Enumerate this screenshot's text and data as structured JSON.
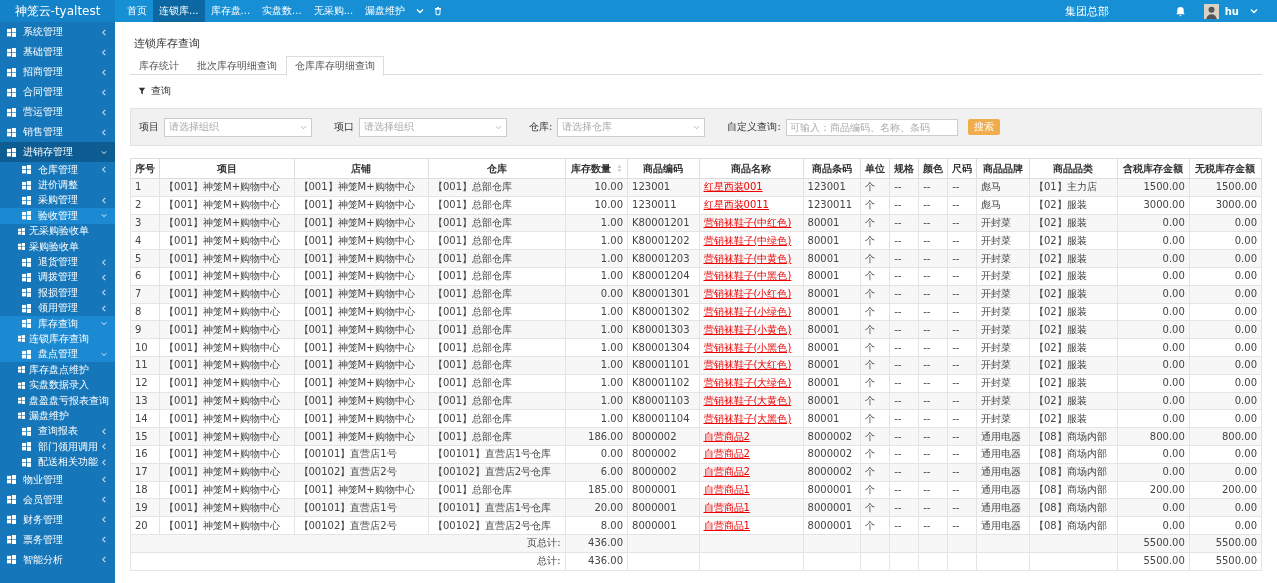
{
  "topbar": {
    "brand": "神笼云-tyaltest",
    "tabs": [
      {
        "label": "首页",
        "selected": false
      },
      {
        "label": "连锁库...",
        "selected": true
      },
      {
        "label": "库存盘...",
        "selected": false
      },
      {
        "label": "实盘数...",
        "selected": false
      },
      {
        "label": "无采购...",
        "selected": false
      },
      {
        "label": "漏盘维护",
        "selected": false
      }
    ],
    "org": "集团总部",
    "user": "hu"
  },
  "sidebar": {
    "items": [
      {
        "label": "系统管理",
        "expandable": true,
        "expanded": false,
        "selected": false
      },
      {
        "label": "基础管理",
        "expandable": true,
        "expanded": false,
        "selected": false
      },
      {
        "label": "招商管理",
        "expandable": true,
        "expanded": false,
        "selected": false
      },
      {
        "label": "合同管理",
        "expandable": true,
        "expanded": false,
        "selected": false
      },
      {
        "label": "营运管理",
        "expandable": true,
        "expanded": false,
        "selected": false
      },
      {
        "label": "销售管理",
        "expandable": true,
        "expanded": false,
        "selected": false
      },
      {
        "label": "进销存管理",
        "expandable": true,
        "expanded": true,
        "selected": true,
        "children": [
          {
            "label": "仓库管理",
            "expandable": true,
            "expanded": false,
            "selected": false
          },
          {
            "label": "进价调整",
            "expandable": false,
            "selected": false
          },
          {
            "label": "采购管理",
            "expandable": true,
            "expanded": false,
            "selected": false
          },
          {
            "label": "验收管理",
            "expandable": true,
            "expanded": true,
            "selected": true,
            "children": [
              {
                "label": "无采购验收单",
                "expandable": false,
                "selected": false
              },
              {
                "label": "采购验收单",
                "expandable": false,
                "selected": false
              }
            ]
          },
          {
            "label": "退货管理",
            "expandable": true,
            "expanded": false,
            "selected": false
          },
          {
            "label": "调拨管理",
            "expandable": true,
            "expanded": false,
            "selected": false
          },
          {
            "label": "报损管理",
            "expandable": true,
            "expanded": false,
            "selected": false
          },
          {
            "label": "领用管理",
            "expandable": true,
            "expanded": false,
            "selected": false
          },
          {
            "label": "库存查询",
            "expandable": true,
            "expanded": true,
            "selected": true,
            "children": [
              {
                "label": "连锁库存查询",
                "expandable": false,
                "selected": true
              }
            ]
          },
          {
            "label": "盘点管理",
            "expandable": true,
            "expanded": true,
            "selected": true,
            "children": [
              {
                "label": "库存盘点维护",
                "expandable": false,
                "selected": false
              },
              {
                "label": "实盘数据录入",
                "expandable": false,
                "selected": false
              },
              {
                "label": "盘盈盘亏报表查询",
                "expandable": false,
                "selected": false
              },
              {
                "label": "漏盘维护",
                "expandable": false,
                "selected": false
              }
            ]
          },
          {
            "label": "查询报表",
            "expandable": true,
            "expanded": false,
            "selected": false
          },
          {
            "label": "部门领用调用",
            "expandable": true,
            "expanded": false,
            "selected": false
          },
          {
            "label": "配送相关功能",
            "expandable": true,
            "expanded": false,
            "selected": false
          }
        ]
      },
      {
        "label": "物业管理",
        "expandable": true,
        "expanded": false,
        "selected": false
      },
      {
        "label": "会员管理",
        "expandable": true,
        "expanded": false,
        "selected": false
      },
      {
        "label": "财务管理",
        "expandable": true,
        "expanded": false,
        "selected": false
      },
      {
        "label": "票务管理",
        "expandable": true,
        "expanded": false,
        "selected": false
      },
      {
        "label": "智能分析",
        "expandable": true,
        "expanded": false,
        "selected": false
      }
    ]
  },
  "page": {
    "title": "连锁库存查询",
    "tabs": [
      {
        "label": "库存统计",
        "selected": false
      },
      {
        "label": "批次库存明细查询",
        "selected": false
      },
      {
        "label": "仓库库存明细查询",
        "selected": true
      }
    ],
    "query_button": "查询",
    "filters": [
      {
        "kind": "select",
        "label": "项目",
        "placeholder": "请选择组织"
      },
      {
        "kind": "select",
        "label": "项口",
        "placeholder": "请选择组织"
      },
      {
        "kind": "select",
        "label": "仓库:",
        "placeholder": "请选择仓库"
      },
      {
        "kind": "text",
        "label": "自定义查询:",
        "placeholder": "可输入：商品编码、名称、条码"
      }
    ],
    "search_button": "搜索"
  },
  "table": {
    "columns": [
      {
        "label": "序号",
        "kind": "index",
        "sortable": false
      },
      {
        "label": "项目",
        "kind": "text",
        "sortable": false
      },
      {
        "label": "店铺",
        "kind": "text",
        "sortable": false
      },
      {
        "label": "仓库",
        "kind": "text",
        "sortable": false
      },
      {
        "label": "库存数量",
        "kind": "number",
        "sortable": true
      },
      {
        "label": "商品编码",
        "kind": "text",
        "sortable": false
      },
      {
        "label": "商品名称",
        "kind": "link",
        "sortable": false
      },
      {
        "label": "商品条码",
        "kind": "text",
        "sortable": false
      },
      {
        "label": "单位",
        "kind": "text",
        "sortable": false
      },
      {
        "label": "规格",
        "kind": "text",
        "sortable": false
      },
      {
        "label": "颜色",
        "kind": "text",
        "sortable": false
      },
      {
        "label": "尺码",
        "kind": "text",
        "sortable": false
      },
      {
        "label": "商品品牌",
        "kind": "text",
        "sortable": false
      },
      {
        "label": "商品品类",
        "kind": "text",
        "sortable": false
      },
      {
        "label": "含税库存金额",
        "kind": "number",
        "sortable": false
      },
      {
        "label": "无税库存金额",
        "kind": "number",
        "sortable": false
      }
    ],
    "rows": [
      [
        "1",
        "【001】神笼M+购物中心",
        "【001】神笼M+购物中心",
        "【001】总部仓库",
        "10.00",
        "123001",
        "红星西装001",
        "123001",
        "个",
        "--",
        "--",
        "--",
        "彪马",
        "【01】主力店",
        "1500.00",
        "1500.00"
      ],
      [
        "2",
        "【001】神笼M+购物中心",
        "【001】神笼M+购物中心",
        "【001】总部仓库",
        "10.00",
        "1230011",
        "红星西装0011",
        "1230011",
        "个",
        "--",
        "--",
        "--",
        "彪马",
        "【02】服装",
        "3000.00",
        "3000.00"
      ],
      [
        "3",
        "【001】神笼M+购物中心",
        "【001】神笼M+购物中心",
        "【001】总部仓库",
        "1.00",
        "K80001201",
        "营销袜鞋子(中红色)",
        "80001",
        "个",
        "--",
        "--",
        "--",
        "开封菜",
        "【02】服装",
        "0.00",
        "0.00"
      ],
      [
        "4",
        "【001】神笼M+购物中心",
        "【001】神笼M+购物中心",
        "【001】总部仓库",
        "1.00",
        "K80001202",
        "营销袜鞋子(中绿色)",
        "80001",
        "个",
        "--",
        "--",
        "--",
        "开封菜",
        "【02】服装",
        "0.00",
        "0.00"
      ],
      [
        "5",
        "【001】神笼M+购物中心",
        "【001】神笼M+购物中心",
        "【001】总部仓库",
        "1.00",
        "K80001203",
        "营销袜鞋子(中黄色)",
        "80001",
        "个",
        "--",
        "--",
        "--",
        "开封菜",
        "【02】服装",
        "0.00",
        "0.00"
      ],
      [
        "6",
        "【001】神笼M+购物中心",
        "【001】神笼M+购物中心",
        "【001】总部仓库",
        "1.00",
        "K80001204",
        "营销袜鞋子(中黑色)",
        "80001",
        "个",
        "--",
        "--",
        "--",
        "开封菜",
        "【02】服装",
        "0.00",
        "0.00"
      ],
      [
        "7",
        "【001】神笼M+购物中心",
        "【001】神笼M+购物中心",
        "【001】总部仓库",
        "0.00",
        "K80001301",
        "营销袜鞋子(小红色)",
        "80001",
        "个",
        "--",
        "--",
        "--",
        "开封菜",
        "【02】服装",
        "0.00",
        "0.00"
      ],
      [
        "8",
        "【001】神笼M+购物中心",
        "【001】神笼M+购物中心",
        "【001】总部仓库",
        "1.00",
        "K80001302",
        "营销袜鞋子(小绿色)",
        "80001",
        "个",
        "--",
        "--",
        "--",
        "开封菜",
        "【02】服装",
        "0.00",
        "0.00"
      ],
      [
        "9",
        "【001】神笼M+购物中心",
        "【001】神笼M+购物中心",
        "【001】总部仓库",
        "1.00",
        "K80001303",
        "营销袜鞋子(小黄色)",
        "80001",
        "个",
        "--",
        "--",
        "--",
        "开封菜",
        "【02】服装",
        "0.00",
        "0.00"
      ],
      [
        "10",
        "【001】神笼M+购物中心",
        "【001】神笼M+购物中心",
        "【001】总部仓库",
        "1.00",
        "K80001304",
        "营销袜鞋子(小黑色)",
        "80001",
        "个",
        "--",
        "--",
        "--",
        "开封菜",
        "【02】服装",
        "0.00",
        "0.00"
      ],
      [
        "11",
        "【001】神笼M+购物中心",
        "【001】神笼M+购物中心",
        "【001】总部仓库",
        "1.00",
        "K80001101",
        "营销袜鞋子(大红色)",
        "80001",
        "个",
        "--",
        "--",
        "--",
        "开封菜",
        "【02】服装",
        "0.00",
        "0.00"
      ],
      [
        "12",
        "【001】神笼M+购物中心",
        "【001】神笼M+购物中心",
        "【001】总部仓库",
        "1.00",
        "K80001102",
        "营销袜鞋子(大绿色)",
        "80001",
        "个",
        "--",
        "--",
        "--",
        "开封菜",
        "【02】服装",
        "0.00",
        "0.00"
      ],
      [
        "13",
        "【001】神笼M+购物中心",
        "【001】神笼M+购物中心",
        "【001】总部仓库",
        "1.00",
        "K80001103",
        "营销袜鞋子(大黄色)",
        "80001",
        "个",
        "--",
        "--",
        "--",
        "开封菜",
        "【02】服装",
        "0.00",
        "0.00"
      ],
      [
        "14",
        "【001】神笼M+购物中心",
        "【001】神笼M+购物中心",
        "【001】总部仓库",
        "1.00",
        "K80001104",
        "营销袜鞋子(大黑色)",
        "80001",
        "个",
        "--",
        "--",
        "--",
        "开封菜",
        "【02】服装",
        "0.00",
        "0.00"
      ],
      [
        "15",
        "【001】神笼M+购物中心",
        "【001】神笼M+购物中心",
        "【001】总部仓库",
        "186.00",
        "8000002",
        "自营商品2",
        "8000002",
        "个",
        "--",
        "--",
        "--",
        "通用电器",
        "【08】商场内部",
        "800.00",
        "800.00"
      ],
      [
        "16",
        "【001】神笼M+购物中心",
        "【00101】直营店1号",
        "【00101】直营店1号仓库",
        "0.00",
        "8000002",
        "自营商品2",
        "8000002",
        "个",
        "--",
        "--",
        "--",
        "通用电器",
        "【08】商场内部",
        "0.00",
        "0.00"
      ],
      [
        "17",
        "【001】神笼M+购物中心",
        "【00102】直营店2号",
        "【00102】直营店2号仓库",
        "6.00",
        "8000002",
        "自营商品2",
        "8000002",
        "个",
        "--",
        "--",
        "--",
        "通用电器",
        "【08】商场内部",
        "0.00",
        "0.00"
      ],
      [
        "18",
        "【001】神笼M+购物中心",
        "【001】神笼M+购物中心",
        "【001】总部仓库",
        "185.00",
        "8000001",
        "自营商品1",
        "8000001",
        "个",
        "--",
        "--",
        "--",
        "通用电器",
        "【08】商场内部",
        "200.00",
        "200.00"
      ],
      [
        "19",
        "【001】神笼M+购物中心",
        "【00101】直营店1号",
        "【00101】直营店1号仓库",
        "20.00",
        "8000001",
        "自营商品1",
        "8000001",
        "个",
        "--",
        "--",
        "--",
        "通用电器",
        "【08】商场内部",
        "0.00",
        "0.00"
      ],
      [
        "20",
        "【001】神笼M+购物中心",
        "【00102】直营店2号",
        "【00102】直营店2号仓库",
        "8.00",
        "8000001",
        "自营商品1",
        "8000001",
        "个",
        "--",
        "--",
        "--",
        "通用电器",
        "【08】商场内部",
        "0.00",
        "0.00"
      ]
    ],
    "totals": [
      {
        "label": "页总计:",
        "quantity": "436.00",
        "tax_amount": "5500.00",
        "net_amount": "5500.00"
      },
      {
        "label": "总计:",
        "quantity": "436.00",
        "tax_amount": "5500.00",
        "net_amount": "5500.00"
      }
    ]
  }
}
